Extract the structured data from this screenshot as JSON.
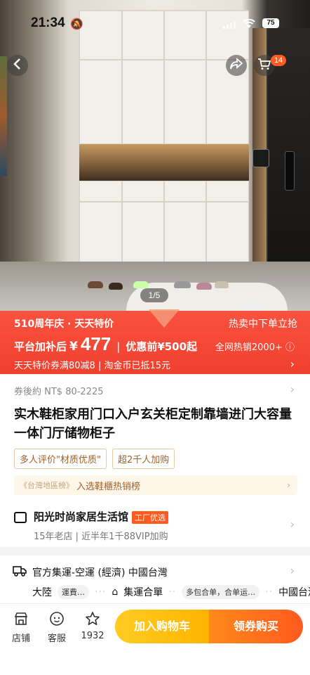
{
  "status": {
    "time": "21:34",
    "battery": "75"
  },
  "gallery": {
    "counter": "1/5",
    "cart_count": "14"
  },
  "promo": {
    "event": "510周年庆 · 天天特价",
    "right_text": "热卖中下单立抢",
    "subsidy_label": "平台加补后",
    "currency": "¥",
    "price": "477",
    "separator": "|",
    "original": "优惠前¥500起",
    "hot": "全网热销2000+ ⓘ",
    "coupon_line": "天天特价券满80减8 | 淘金币已抵15元"
  },
  "product": {
    "coupon_price": "券後約 NT$ 80-2225",
    "title": "实木鞋柜家用门口入户玄关柜定制靠墙进门大容量一体门厅储物柜子",
    "tags": [
      "多人评价\"材质优质\"",
      "超2千人加购"
    ],
    "rank_region": "《台灣地區榜》",
    "rank_text": "入选鞋櫃热销榜"
  },
  "shop": {
    "name": "阳光时尚家居生活馆",
    "badge": "工厂优选",
    "sub": "15年老店 | 近半年1千88VIP加购"
  },
  "shipping": {
    "title": "官方集運-空運 (經濟) 中國台灣",
    "from": "大陸",
    "step1": "運費…",
    "step2": "集運合單",
    "step3": "多包合单，合单运…",
    "to": "中國台灣"
  },
  "bottom_bar": {
    "store": "店铺",
    "service": "客服",
    "favorites": "1932",
    "add_cart": "加入购物车",
    "buy": "领券购买"
  },
  "colors": {
    "accent": "#ff5a1f",
    "promo_bg": "#f0402f",
    "cart_btn": "#ffb400"
  }
}
